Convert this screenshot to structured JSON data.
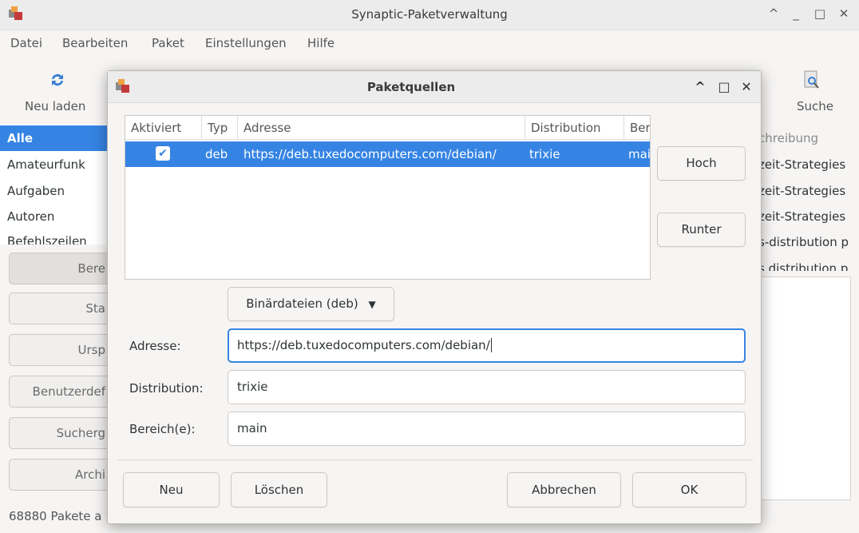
{
  "main_window": {
    "title": "Synaptic-Paketverwaltung",
    "window_controls": {
      "up": "^",
      "minimize": "_",
      "maximize": "□",
      "close": "✕"
    },
    "menu": [
      "Datei",
      "Bearbeiten",
      "Paket",
      "Einstellungen",
      "Hilfe"
    ],
    "toolbar": {
      "reload_label": "Neu laden",
      "search_label": "Suche"
    },
    "filter_list": [
      "Alle",
      "Amateurfunk",
      "Aufgaben",
      "Autoren",
      "Befehlszeilen"
    ],
    "side_buttons": [
      "Bere",
      "Sta",
      "Ursp",
      "Benutzerdef",
      "Sucherg",
      "Archi"
    ],
    "right_header": "chreibung",
    "right_rows": [
      "zeit-Strategies",
      "zeit-Strategies",
      "zeit-Strategies",
      "s-distribution p",
      "s distribution p"
    ],
    "status": "68880 Pakete a"
  },
  "dialog": {
    "title": "Paketquellen",
    "controls": {
      "up": "^",
      "maximize": "□",
      "close": "✕"
    },
    "table": {
      "headers": [
        "Aktiviert",
        "Typ",
        "Adresse",
        "Distribution",
        "Ber"
      ],
      "rows": [
        {
          "enabled": true,
          "type": "deb",
          "address": "https://deb.tuxedocomputers.com/debian/",
          "distribution": "trixie",
          "section": "mai"
        }
      ]
    },
    "up_button": "Hoch",
    "down_button": "Runter",
    "type_combo": "Binärdateien (deb)",
    "address_label": "Adresse:",
    "address_value": "https://deb.tuxedocomputers.com/debian/",
    "distribution_label": "Distribution:",
    "distribution_value": "trixie",
    "sections_label": "Bereich(e):",
    "sections_value": "main",
    "new_button": "Neu",
    "delete_button": "Löschen",
    "cancel_button": "Abbrechen",
    "ok_button": "OK"
  },
  "colors": {
    "accent": "#3584e4",
    "window_bg": "#f6f5f4"
  }
}
